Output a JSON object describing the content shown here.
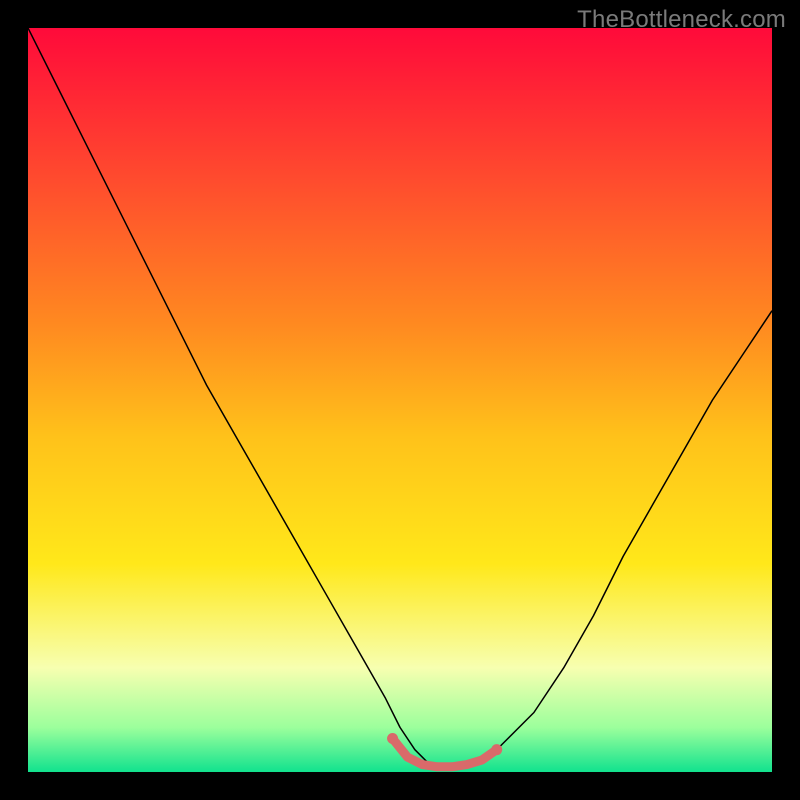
{
  "watermark": "TheBottleneck.com",
  "chart_data": {
    "type": "line",
    "title": "",
    "xlabel": "",
    "ylabel": "",
    "xlim": [
      0,
      100
    ],
    "ylim": [
      0,
      100
    ],
    "background_gradient": {
      "type": "vertical",
      "stops": [
        {
          "pos": 0.0,
          "color": "#ff0a3a"
        },
        {
          "pos": 0.2,
          "color": "#ff4a2e"
        },
        {
          "pos": 0.4,
          "color": "#ff8a20"
        },
        {
          "pos": 0.55,
          "color": "#ffc21a"
        },
        {
          "pos": 0.72,
          "color": "#ffe81a"
        },
        {
          "pos": 0.86,
          "color": "#f7ffb0"
        },
        {
          "pos": 0.94,
          "color": "#9cff9c"
        },
        {
          "pos": 1.0,
          "color": "#11e28e"
        }
      ]
    },
    "series": [
      {
        "name": "bottleneck-curve",
        "color": "#000000",
        "stroke_width": 1.5,
        "x": [
          0,
          4,
          8,
          12,
          16,
          20,
          24,
          28,
          32,
          36,
          40,
          44,
          48,
          50,
          52,
          54,
          56,
          58,
          60,
          62,
          64,
          68,
          72,
          76,
          80,
          84,
          88,
          92,
          96,
          100
        ],
        "y": [
          100,
          92,
          84,
          76,
          68,
          60,
          52,
          45,
          38,
          31,
          24,
          17,
          10,
          6,
          3,
          1,
          0.5,
          0.5,
          1,
          2,
          4,
          8,
          14,
          21,
          29,
          36,
          43,
          50,
          56,
          62
        ]
      },
      {
        "name": "optimal-range-marker",
        "color": "#d96a6a",
        "stroke_width": 9,
        "line_cap": "round",
        "x": [
          49,
          51,
          53,
          55,
          57,
          59,
          61,
          63
        ],
        "y": [
          4.5,
          2.0,
          1.0,
          0.7,
          0.7,
          1.0,
          1.6,
          3.0
        ]
      }
    ],
    "legend": null,
    "grid": false
  }
}
